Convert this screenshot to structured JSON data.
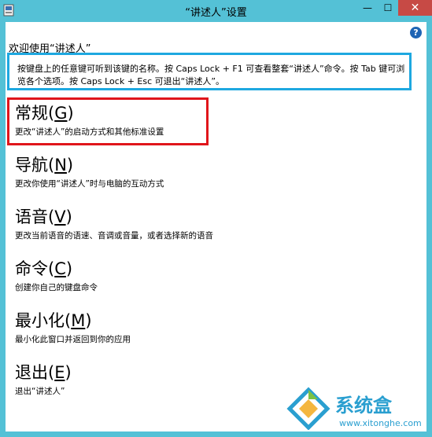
{
  "window": {
    "title": "“讲述人”设置",
    "minimize_glyph": "—",
    "maximize_glyph": "☐",
    "close_glyph": "✕"
  },
  "help_icon_glyph": "?",
  "welcome": "欢迎使用“讲述人”",
  "info": "按键盘上的任意键可听到该键的名称。按 Caps Lock + F1 可查看整套“讲述人”命令。按 Tab 键可浏览各个选项。按 Caps Lock + Esc 可退出“讲述人”。",
  "items": [
    {
      "name": "常规",
      "key": "G",
      "desc": "更改“讲述人”的启动方式和其他标准设置"
    },
    {
      "name": "导航",
      "key": "N",
      "desc": "更改你使用“讲述人”时与电脑的互动方式"
    },
    {
      "name": "语音",
      "key": "V",
      "desc": "更改当前语音的语速、音调或音量，或者选择新的语音"
    },
    {
      "name": "命令",
      "key": "C",
      "desc": "创建你自己的键盘命令"
    },
    {
      "name": "最小化",
      "key": "M",
      "desc": "最小化此窗口并返回到你的应用"
    },
    {
      "name": "退出",
      "key": "E",
      "desc": "退出“讲述人”"
    }
  ],
  "watermark": {
    "text": "系统盒",
    "url": "www.xitonghe.com"
  },
  "colors": {
    "titlebar": "#54c1d6",
    "close": "#c74a45",
    "info_border": "#1ea8e0",
    "highlight": "#e0151b"
  }
}
